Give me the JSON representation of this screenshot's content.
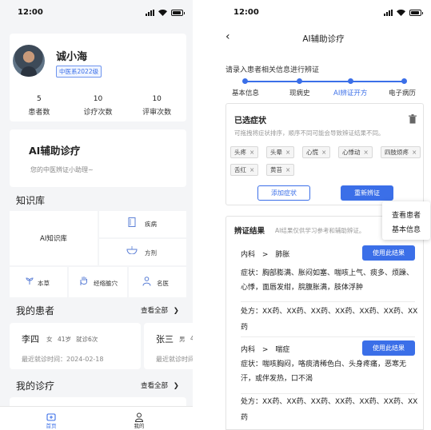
{
  "left": {
    "status_time": "12:00",
    "profile": {
      "name": "诚小海",
      "tag": "中医系2022级",
      "stats": [
        {
          "value": "5",
          "label": "患者数"
        },
        {
          "value": "10",
          "label": "诊疗次数"
        },
        {
          "value": "10",
          "label": "评审次数"
        }
      ]
    },
    "ai_card": {
      "title": "AI辅助诊疗",
      "subtitle": "您的中医辨证小助理~"
    },
    "knowledge": {
      "title": "知识库",
      "main": "AI知识库",
      "items": [
        {
          "label": "疾病",
          "icon": "book-icon"
        },
        {
          "label": "方剂",
          "icon": "bowl-icon"
        },
        {
          "label": "本草",
          "icon": "herb-icon"
        },
        {
          "label": "经络腧穴",
          "icon": "hand-icon"
        },
        {
          "label": "名医",
          "icon": "doctor-icon"
        }
      ]
    },
    "patients": {
      "title": "我的患者",
      "see_all": "查看全部",
      "list": [
        {
          "name": "李四",
          "gender": "女",
          "age": "41岁",
          "visits": "就诊6次",
          "last_visit": "最近就诊时间：2024-02-18"
        },
        {
          "name": "张三",
          "gender": "男",
          "age": "4",
          "visits": "",
          "last_visit": "最近就诊时间"
        }
      ]
    },
    "diagnosis": {
      "title": "我的诊疗",
      "see_all": "查看全部"
    },
    "tabs": [
      {
        "label": "首页",
        "active": true
      },
      {
        "label": "我的",
        "active": false
      }
    ]
  },
  "right": {
    "status_time": "12:00",
    "nav_title": "AI辅助诊疗",
    "hint": "请录入患者相关信息进行辨证",
    "steps": [
      {
        "label": "基本信息",
        "active": false
      },
      {
        "label": "现病史",
        "active": false
      },
      {
        "label": "AI辨证开方",
        "active": true
      },
      {
        "label": "电子病历",
        "active": false
      }
    ],
    "symptoms": {
      "title": "已选症状",
      "note": "可拖拽将症状排序，顺序不同可能会导致辨证结果不同。",
      "chips": [
        "头疼",
        "头晕",
        "心慌",
        "心悸动",
        "四肢烦疼",
        "舌红",
        "黄苔"
      ],
      "add_label": "添加症状",
      "rediagnose_label": "重新辨证"
    },
    "popup": {
      "line1": "查看患者",
      "line2": "基本信息"
    },
    "result": {
      "title": "辨证结果",
      "note": "AI结果仅供学习参考和辅助辨证。",
      "use_label": "使用此结果",
      "items": [
        {
          "dept": "内科",
          "sep": ">",
          "disease": "肺胀",
          "symptoms": "症状：胸部膨满、胀闷如塞、喘咳上气、痰多、烦躁、心悸，面唇发绀，脘腹胀满，肢体浮肿",
          "rx": "处方：XX药、XX药、XX药、XX药、XX药、XX药、XX药"
        },
        {
          "dept": "内科",
          "sep": ">",
          "disease": "喘症",
          "symptoms": "症状：喘咳胸闷，咯痰清稀色白、头身疼痛，恶寒无汗，或伴发热，口不渴",
          "rx": "处方：XX药、XX药、XX药、XX药、XX药、XX药、XX药"
        }
      ]
    }
  }
}
